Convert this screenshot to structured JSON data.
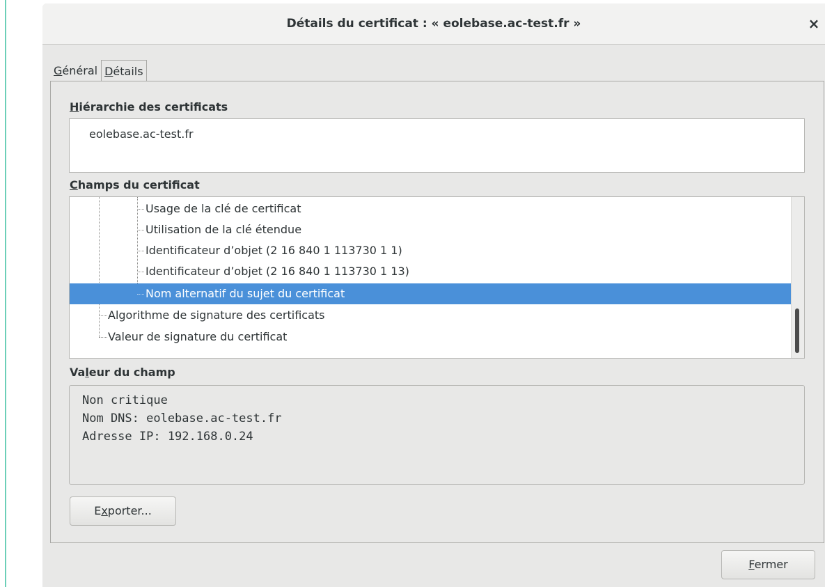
{
  "dialog": {
    "title": "Détails du certificat : « eolebase.ac-test.fr »",
    "close_glyph": "×"
  },
  "tabs": [
    {
      "mnemonic": "G",
      "rest": "énéral",
      "active": false
    },
    {
      "mnemonic": "D",
      "rest": "étails",
      "active": true
    }
  ],
  "hierarchy": {
    "label_mnemonic": "H",
    "label_rest": "iérarchie des certificats",
    "items": [
      "eolebase.ac-test.fr"
    ]
  },
  "fields": {
    "label_mnemonic": "C",
    "label_rest": "hamps du certificat",
    "rows": [
      "Usage de la clé de certificat",
      "Utilisation de la clé étendue",
      "Identificateur d’objet (2 16 840 1 113730 1 1)",
      "Identificateur d’objet (2 16 840 1 113730 1 13)",
      "Nom alternatif du sujet du certificat",
      "Algorithme de signature des certificats",
      "Valeur de signature du certificat"
    ],
    "selected_index": 4
  },
  "value": {
    "label_pre": "Va",
    "label_mnemonic": "l",
    "label_rest": "eur du champ",
    "lines": [
      "Non critique",
      "Nom DNS: eolebase.ac-test.fr",
      "Adresse IP: 192.168.0.24"
    ]
  },
  "buttons": {
    "export_pre": "E",
    "export_mnemonic": "x",
    "export_rest": "porter...",
    "close_mnemonic": "F",
    "close_rest": "ermer"
  },
  "colors": {
    "selection": "#4a90d9",
    "accent_line": "#6ccfb8"
  }
}
